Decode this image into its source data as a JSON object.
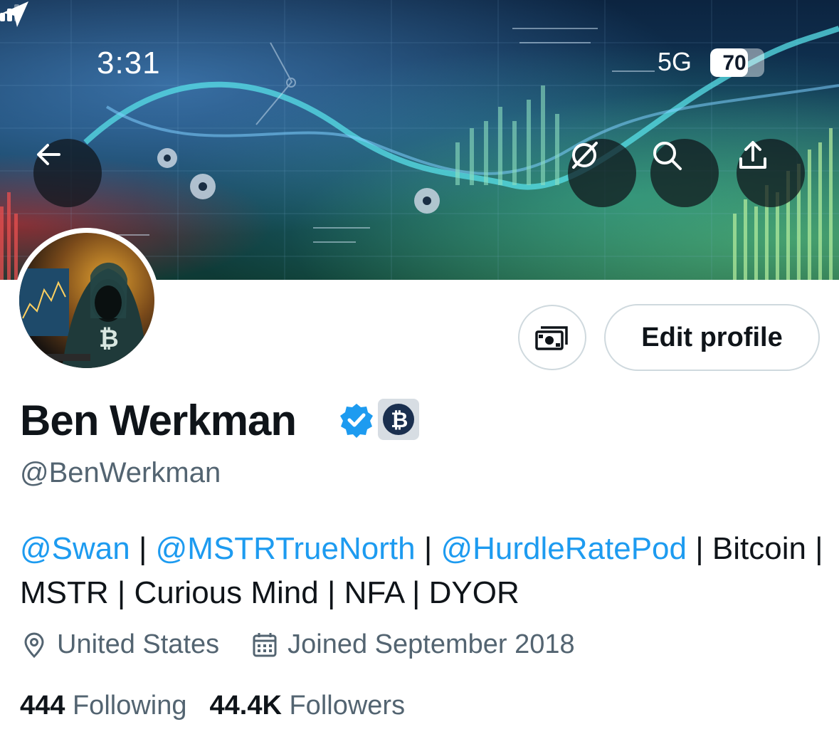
{
  "status_bar": {
    "time": "3:31",
    "network": "5G",
    "battery": "70",
    "battery_level": 0.7
  },
  "header": {
    "back_icon": "arrow-left-icon",
    "grok_icon": "slashed-circle-icon",
    "search_icon": "search-icon",
    "share_icon": "share-upload-icon"
  },
  "profile": {
    "name": "Ben Werkman",
    "handle": "@BenWerkman",
    "verified_icon": "verified-badge-icon",
    "affiliate_icon": "bitcoin-icon",
    "tip_icon": "money-icon",
    "edit_label": "Edit profile",
    "bio": {
      "mention1": "@Swan",
      "sep1": " | ",
      "mention2": "@MSTRTrueNorth",
      "sep2": " | ",
      "mention3": "@HurdleRatePod",
      "rest_line1": " | Bitcoin |",
      "rest_line2": "MSTR | Curious Mind | NFA | DYOR"
    },
    "location": "United States",
    "joined": "Joined September 2018",
    "following_count": "444",
    "following_label": "Following",
    "followers_count": "44.4K",
    "followers_label": "Followers"
  },
  "colors": {
    "link": "#1d9bf0",
    "secondary": "#536471",
    "verified": "#1d9bf0"
  }
}
